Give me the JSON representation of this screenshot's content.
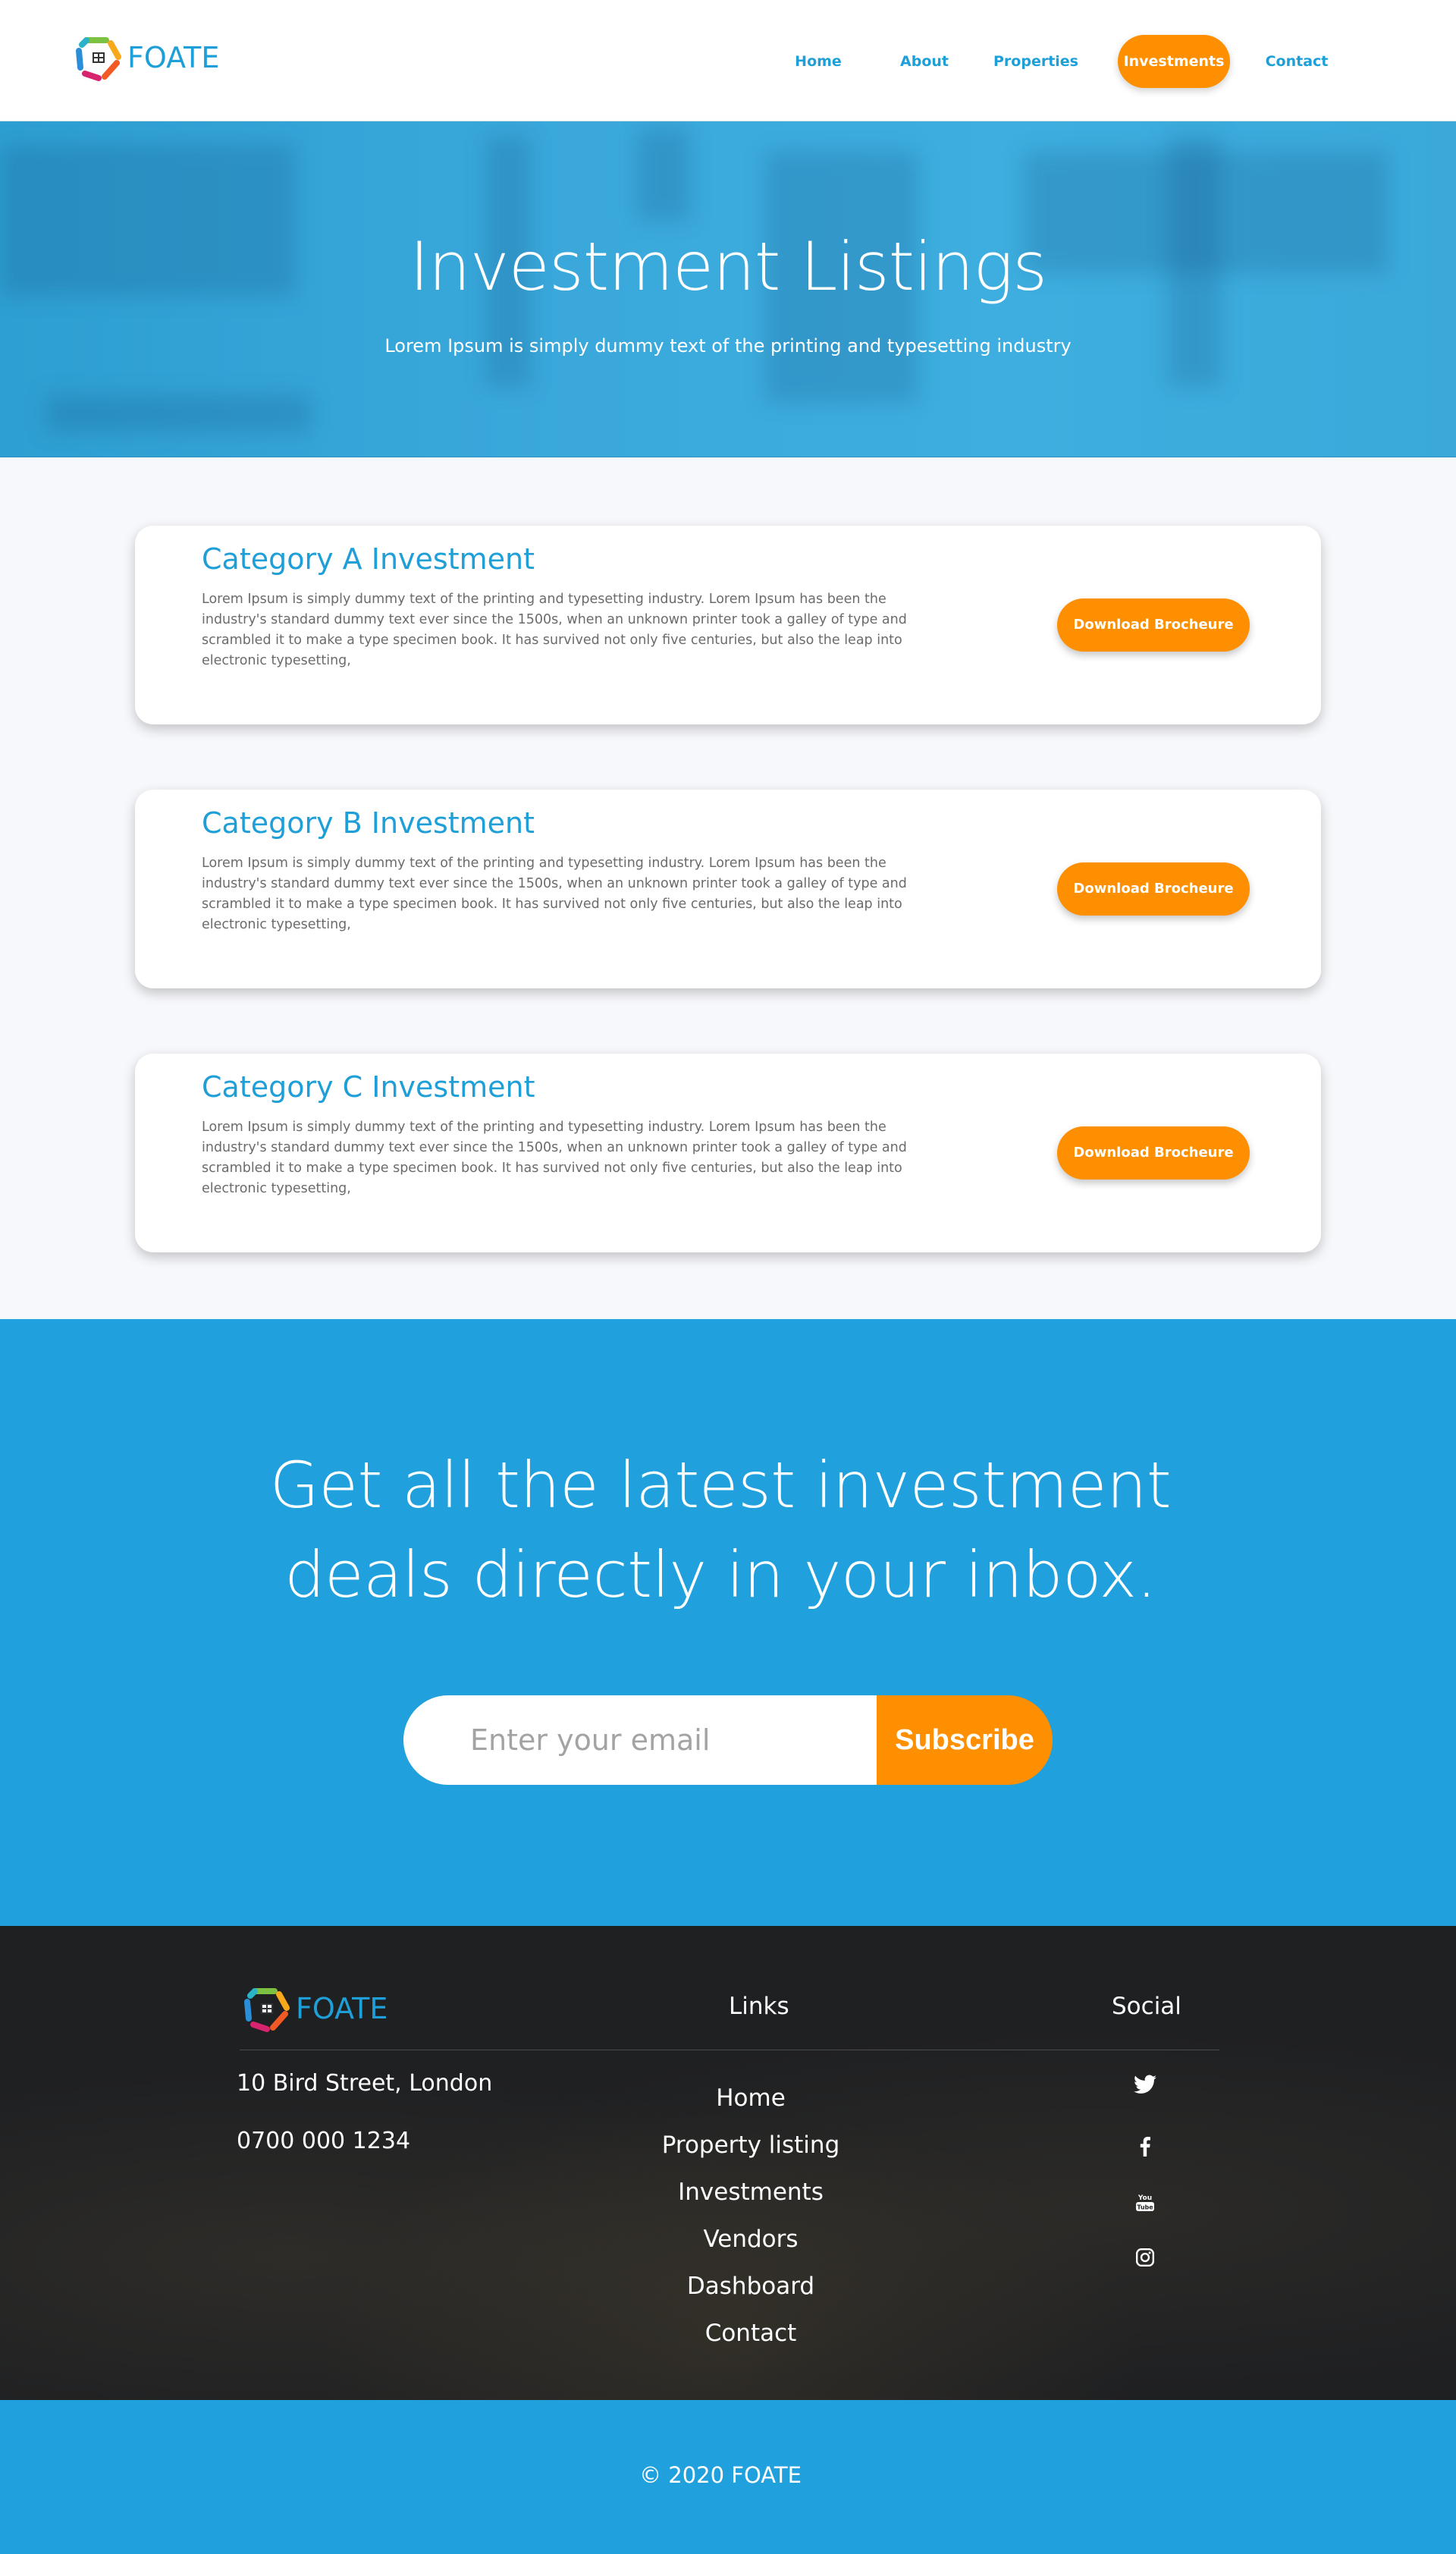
{
  "brand": {
    "name": "FOATE"
  },
  "nav": {
    "items": [
      {
        "label": "Home",
        "active": false
      },
      {
        "label": "About",
        "active": false
      },
      {
        "label": "Properties",
        "active": false
      },
      {
        "label": "Investments",
        "active": true
      },
      {
        "label": "Contact",
        "active": false
      }
    ]
  },
  "hero": {
    "title": "Investment Listings",
    "subtitle": "Lorem Ipsum is simply dummy text of the printing and typesetting industry"
  },
  "listings": [
    {
      "title": "Category A Investment",
      "description": "Lorem Ipsum is simply dummy text of the printing and typesetting industry. Lorem Ipsum has been the industry's standard dummy text ever since the 1500s, when an unknown printer took a galley of type and scrambled it to make a type specimen book. It has survived not only five centuries, but also the leap into electronic typesetting,",
      "button": "Download Brocheure"
    },
    {
      "title": "Category B Investment",
      "description": "Lorem Ipsum is simply dummy text of the printing and typesetting industry. Lorem Ipsum has been the industry's standard dummy text ever since the 1500s, when an unknown printer took a galley of type and scrambled it to make a type specimen book. It has survived not only five centuries, but also the leap into electronic typesetting,",
      "button": "Download Brocheure"
    },
    {
      "title": "Category C Investment",
      "description": "Lorem Ipsum is simply dummy text of the printing and typesetting industry. Lorem Ipsum has been the industry's standard dummy text ever since the 1500s, when an unknown printer took a galley of type and scrambled it to make a type specimen book. It has survived not only five centuries, but also the leap into electronic typesetting,",
      "button": "Download Brocheure"
    }
  ],
  "newsletter": {
    "title_line1": "Get all the latest investment",
    "title_line2": "deals directly in your inbox.",
    "email_placeholder": "Enter your email",
    "button": "Subscribe"
  },
  "footer": {
    "address": "10 Bird Street, London",
    "phone": "0700 000 1234",
    "links_heading": "Links",
    "links": [
      "Home",
      "Property listing",
      "Investments",
      "Vendors",
      "Dashboard",
      "Contact"
    ],
    "social_heading": "Social",
    "social": [
      "twitter-icon",
      "facebook-icon",
      "youtube-icon",
      "instagram-icon"
    ]
  },
  "copyright": "© 2020 FOATE",
  "colors": {
    "primary": "#1e9fd8",
    "accent": "#fd8f00",
    "band": "#20a0dc",
    "footer_bg": "#1f2022"
  }
}
